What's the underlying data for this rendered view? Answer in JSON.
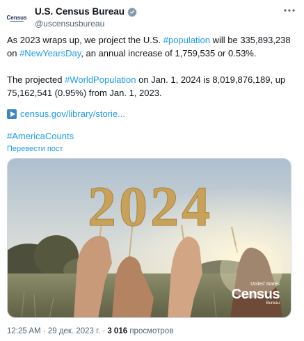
{
  "author": {
    "display_name": "U.S. Census Bureau",
    "handle": "@uscensusbureau",
    "avatar_text": "Census"
  },
  "tweet": {
    "line1_a": "As 2023 wraps up, we project the U.S. ",
    "line1_tag": "#population",
    "line1_b": " will be 335,893,238",
    "line2_a": "on ",
    "line2_tag": "#NewYearsDay",
    "line2_b": ", an annual increase of 1,759,535 or 0.53%.",
    "line3_a": "The projected ",
    "line3_tag": "#WorldPopulation",
    "line3_b": " on Jan. 1, 2024 is 8,019,876,189, up",
    "line4": "75,162,541 (0.95%) from Jan. 1, 2023.",
    "link_text": "census.gov/library/storie...",
    "hashtag": "#AmericaCounts",
    "translate_label": "Перевести пост"
  },
  "media": {
    "year_text": "2024",
    "logo_top": "United States",
    "logo_main": "Census",
    "logo_bottom": "Bureau"
  },
  "footer": {
    "time": "12:25 AM",
    "sep1": " · ",
    "date": "29 дек. 2023 г.",
    "sep2": " · ",
    "views_count": "3 016",
    "views_label": " просмотров"
  },
  "colors": {
    "link": "#1d9bf0",
    "muted": "#536471",
    "verified": "#829aab",
    "gold": "#c9a25a"
  },
  "icons": [
    "verified-badge-icon",
    "more-options-icon",
    "play-icon"
  ]
}
